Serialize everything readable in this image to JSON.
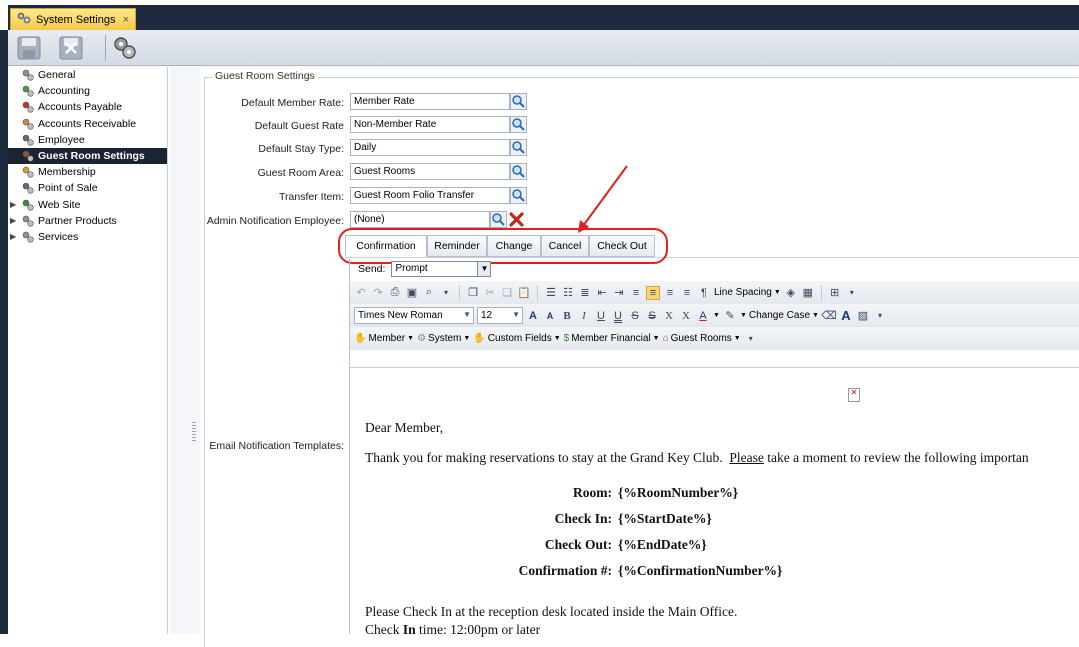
{
  "window": {
    "tab_title": "System Settings",
    "close_glyph": "×"
  },
  "toolbar": {
    "buttons": [
      "save-icon",
      "cancel-icon",
      "settings-gear-icon"
    ]
  },
  "nav": {
    "items": [
      {
        "label": "General",
        "icon": "gears-icon",
        "selected": false,
        "expandable": false
      },
      {
        "label": "Accounting",
        "icon": "accounting-icon",
        "selected": false,
        "expandable": false
      },
      {
        "label": "Accounts Payable",
        "icon": "accounts-payable-icon",
        "selected": false,
        "expandable": false
      },
      {
        "label": "Accounts Receivable",
        "icon": "accounts-receivable-icon",
        "selected": false,
        "expandable": false
      },
      {
        "label": "Employee",
        "icon": "employee-icon",
        "selected": false,
        "expandable": false
      },
      {
        "label": "Guest Room Settings",
        "icon": "guest-room-icon",
        "selected": true,
        "expandable": false
      },
      {
        "label": "Membership",
        "icon": "membership-icon",
        "selected": false,
        "expandable": false
      },
      {
        "label": "Point of Sale",
        "icon": "point-of-sale-icon",
        "selected": false,
        "expandable": false
      },
      {
        "label": "Web Site",
        "icon": "web-site-icon",
        "selected": false,
        "expandable": true
      },
      {
        "label": "Partner Products",
        "icon": "partner-products-icon",
        "selected": false,
        "expandable": true
      },
      {
        "label": "Services",
        "icon": "services-icon",
        "selected": false,
        "expandable": true
      }
    ]
  },
  "group": {
    "title": "Guest Room Settings",
    "fields": [
      {
        "label": "Default Member Rate:",
        "value": "Member Rate"
      },
      {
        "label": "Default Guest Rate",
        "value": "Non-Member Rate"
      },
      {
        "label": "Default Stay Type:",
        "value": "Daily"
      },
      {
        "label": "Guest Room Area:",
        "value": "Guest Rooms"
      },
      {
        "label": "Transfer Item:",
        "value": "Guest Room Folio Transfer"
      },
      {
        "label": "Admin Notification Employee:",
        "value": "(None)"
      }
    ],
    "email_label": "Email Notification Templates:"
  },
  "template_tabs": [
    "Confirmation",
    "Reminder",
    "Change",
    "Cancel",
    "Check Out"
  ],
  "send": {
    "label": "Send:",
    "value": "Prompt"
  },
  "ribbon": {
    "line_spacing": "Line Spacing",
    "font": "Times New Roman",
    "size": "12",
    "change_case": "Change Case",
    "grow_font": "A",
    "shrink_font": "A",
    "bold": "B",
    "italic": "I",
    "underline": "U",
    "double_underline": "U",
    "strike": "S",
    "double_strike": "S",
    "superscript": "X",
    "subscript": "X",
    "font_color": "A",
    "text_style": "A",
    "merge_menus": [
      "Member",
      "System",
      "Custom Fields",
      "Member Financial",
      "Guest Rooms"
    ]
  },
  "document": {
    "greeting": "Dear Member,",
    "intro_prefix": "Thank you for making reservations to stay at the Grand Key Club.  ",
    "intro_link": "Please",
    "intro_suffix": " take a moment to review the following importan",
    "rows": [
      {
        "k": "Room:",
        "v": "{%RoomNumber%}"
      },
      {
        "k": "Check In:",
        "v": "{%StartDate%}"
      },
      {
        "k": "Check Out:",
        "v": "{%EndDate%}"
      },
      {
        "k": "Confirmation #:",
        "v": "{%ConfirmationNumber%}"
      }
    ],
    "note1": "Please Check In at the reception desk located inside the Main Office.",
    "note2_prefix": "Check ",
    "note2_bold": "In",
    "note2_suffix": " time: 12:00pm or later"
  },
  "colors": {
    "selected_nav": "#1b2433",
    "frame": "#1e2a3e",
    "tab": "#f5c84a",
    "annotation": "#e02020"
  }
}
